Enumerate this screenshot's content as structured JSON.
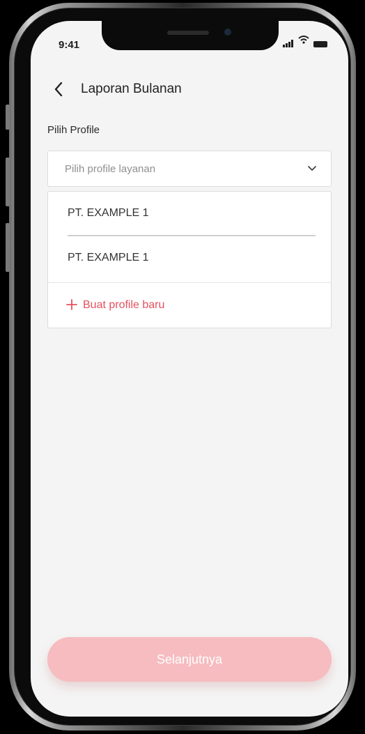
{
  "status_bar": {
    "time": "9:41",
    "signal_icon": "cellular-signal-icon",
    "wifi_icon": "wifi-icon",
    "battery_icon": "battery-icon"
  },
  "header": {
    "back_icon": "chevron-left-icon",
    "title": "Laporan Bulanan"
  },
  "form": {
    "section_label": "Pilih Profile",
    "select": {
      "placeholder": "Pilih profile layanan",
      "icon": "chevron-down-icon"
    },
    "options": [
      "PT. EXAMPLE 1",
      "PT. EXAMPLE 1"
    ],
    "create_profile": {
      "icon": "plus-icon",
      "label": "Buat profile baru"
    }
  },
  "footer": {
    "next_label": "Selanjutnya"
  },
  "colors": {
    "accent": "#e5505d",
    "button_disabled": "#f6bcbf",
    "screen_background": "#f4f4f4"
  }
}
